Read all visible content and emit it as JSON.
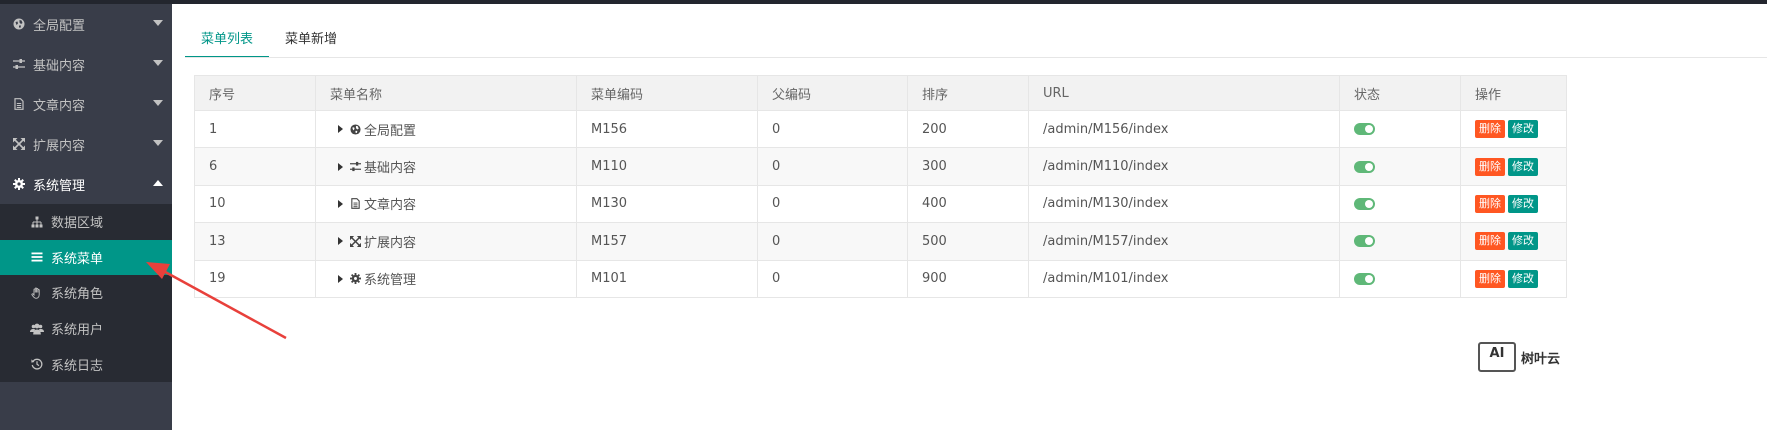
{
  "sidebar": {
    "groups": [
      {
        "label": "全局配置",
        "icon": "globe-icon"
      },
      {
        "label": "基础内容",
        "icon": "sliders-icon"
      },
      {
        "label": "文章内容",
        "icon": "document-icon"
      },
      {
        "label": "扩展内容",
        "icon": "expand-icon"
      },
      {
        "label": "系统管理",
        "icon": "gear-icon"
      }
    ],
    "subitems": [
      {
        "label": "数据区域",
        "icon": "sitemap-icon"
      },
      {
        "label": "系统菜单",
        "icon": "list-icon"
      },
      {
        "label": "系统角色",
        "icon": "hand-icon"
      },
      {
        "label": "系统用户",
        "icon": "users-icon"
      },
      {
        "label": "系统日志",
        "icon": "history-icon"
      }
    ]
  },
  "tabs": [
    {
      "label": "菜单列表"
    },
    {
      "label": "菜单新增"
    }
  ],
  "table": {
    "headers": [
      "序号",
      "菜单名称",
      "菜单编码",
      "父编码",
      "排序",
      "URL",
      "状态",
      "操作"
    ],
    "rows": [
      {
        "id": "1",
        "name": "全局配置",
        "code": "M156",
        "parent": "0",
        "sort": "200",
        "url": "/admin/M156/index"
      },
      {
        "id": "6",
        "name": "基础内容",
        "code": "M110",
        "parent": "0",
        "sort": "300",
        "url": "/admin/M110/index"
      },
      {
        "id": "10",
        "name": "文章内容",
        "code": "M130",
        "parent": "0",
        "sort": "400",
        "url": "/admin/M130/index"
      },
      {
        "id": "13",
        "name": "扩展内容",
        "code": "M157",
        "parent": "0",
        "sort": "500",
        "url": "/admin/M157/index"
      },
      {
        "id": "19",
        "name": "系统管理",
        "code": "M101",
        "parent": "0",
        "sort": "900",
        "url": "/admin/M101/index"
      }
    ],
    "delete_label": "删除",
    "edit_label": "修改"
  },
  "watermark": {
    "box": "AI",
    "text": "树叶云"
  },
  "colors": {
    "accent": "#009688",
    "danger": "#ff5722",
    "toggle_on": "#5fb878",
    "sidebar": "#393d49",
    "annotation_arrow": "#e8403b"
  }
}
